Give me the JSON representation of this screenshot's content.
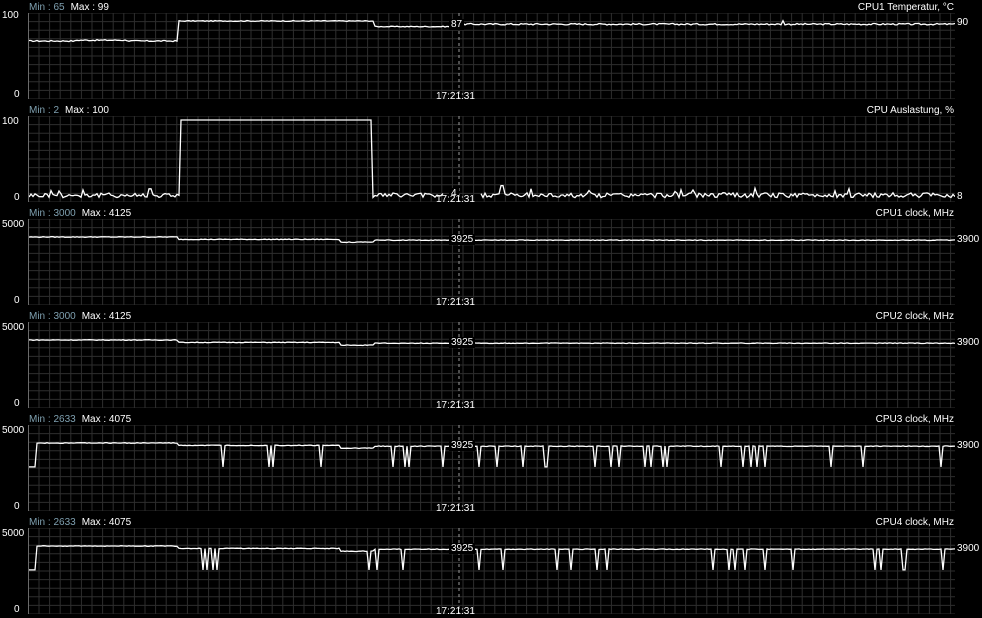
{
  "charts": [
    {
      "title": "CPU1 Temperatur, °C",
      "min_label": "Min : 65",
      "max_label": "Max : 99",
      "y_max": "100",
      "y_min": "0",
      "current": "90",
      "cursor_value": "87",
      "time": "17:21:31",
      "ymax_val": 100,
      "ymin_val": 0,
      "kind": "temp"
    },
    {
      "title": "CPU Auslastung, %",
      "min_label": "Min : 2",
      "max_label": "Max : 100",
      "y_max": "100",
      "y_min": "0",
      "current": "8",
      "cursor_value": "4",
      "time": "17:21:31",
      "ymax_val": 100,
      "ymin_val": 0,
      "kind": "load"
    },
    {
      "title": "CPU1 clock, MHz",
      "min_label": "Min : 3000",
      "max_label": "Max : 4125",
      "y_max": "5000",
      "y_min": "0",
      "current": "3900",
      "cursor_value": "3925",
      "time": "17:21:31",
      "ymax_val": 5000,
      "ymin_val": 0,
      "kind": "clock"
    },
    {
      "title": "CPU2 clock, MHz",
      "min_label": "Min : 3000",
      "max_label": "Max : 4125",
      "y_max": "5000",
      "y_min": "0",
      "current": "3900",
      "cursor_value": "3925",
      "time": "17:21:31",
      "ymax_val": 5000,
      "ymin_val": 0,
      "kind": "clock"
    },
    {
      "title": "CPU3 clock, MHz",
      "min_label": "Min : 2633",
      "max_label": "Max : 4075",
      "y_max": "5000",
      "y_min": "0",
      "current": "3900",
      "cursor_value": "3925",
      "time": "17:21:31",
      "ymax_val": 5000,
      "ymin_val": 0,
      "kind": "clock-dips"
    },
    {
      "title": "CPU4 clock, MHz",
      "min_label": "Min : 2633",
      "max_label": "Max : 4075",
      "y_max": "5000",
      "y_min": "0",
      "current": "3900",
      "cursor_value": "3925",
      "time": "17:21:31",
      "ymax_val": 5000,
      "ymin_val": 0,
      "kind": "clock-dips"
    }
  ],
  "colors": {
    "grid": "#2e2e2e",
    "line": "#ffffff",
    "minlabel": "#7fa0b0",
    "cursor": "#9a9a9a"
  }
}
